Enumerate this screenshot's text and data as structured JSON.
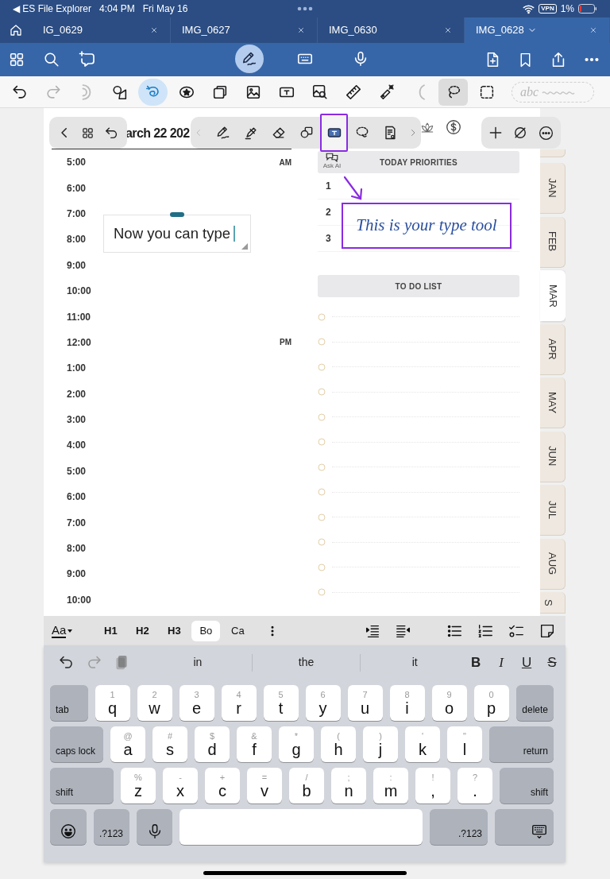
{
  "status_bar": {
    "back_app": "◀ ES File Explorer",
    "time": "4:04 PM",
    "date": "Fri May 16",
    "vpn": "VPN",
    "battery": "1%"
  },
  "doc_tabs": [
    {
      "label": "IG_0629",
      "selected": false
    },
    {
      "label": "IMG_0627",
      "selected": false
    },
    {
      "label": "IMG_0630",
      "selected": false
    },
    {
      "label": "IMG_0628",
      "selected": true
    }
  ],
  "input_modes": [
    {
      "kind": "pen",
      "selected": true
    },
    {
      "kind": "keyboard",
      "selected": false
    },
    {
      "kind": "mic",
      "selected": false
    }
  ],
  "tools": [
    {
      "kind": "undo",
      "selected": false
    },
    {
      "kind": "redo",
      "selected": false
    },
    {
      "kind": "ring",
      "selected": false
    },
    {
      "kind": "shapes",
      "selected": false
    },
    {
      "kind": "swirl",
      "selected": true
    },
    {
      "kind": "sticker",
      "selected": false
    },
    {
      "kind": "pages",
      "selected": false
    },
    {
      "kind": "image",
      "selected": false
    },
    {
      "kind": "textbox",
      "selected": false
    },
    {
      "kind": "imagesearch",
      "selected": false
    },
    {
      "kind": "ruler",
      "selected": false
    },
    {
      "kind": "laser",
      "selected": false
    },
    {
      "kind": "moon",
      "selected": false
    },
    {
      "kind": "lasso",
      "selected": true
    },
    {
      "kind": "select",
      "selected": false
    }
  ],
  "handwriting_preview": "abc",
  "pen_tools": [
    {
      "kind": "pen",
      "selected": false
    },
    {
      "kind": "highlighter",
      "selected": false
    },
    {
      "kind": "eraser",
      "selected": false
    },
    {
      "kind": "shapes",
      "selected": false
    },
    {
      "kind": "text",
      "selected": true
    },
    {
      "kind": "lasso",
      "selected": false
    },
    {
      "kind": "reader",
      "selected": false
    }
  ],
  "planner": {
    "title": "arch 22 202",
    "times": [
      {
        "time": "5:00",
        "meridiem": "AM"
      },
      {
        "time": "6:00"
      },
      {
        "time": "7:00"
      },
      {
        "time": "8:00"
      },
      {
        "time": "9:00"
      },
      {
        "time": "10:00"
      },
      {
        "time": "11:00"
      },
      {
        "time": "12:00",
        "meridiem": "PM"
      },
      {
        "time": "1:00"
      },
      {
        "time": "2:00"
      },
      {
        "time": "3:00"
      },
      {
        "time": "4:00"
      },
      {
        "time": "5:00"
      },
      {
        "time": "6:00"
      },
      {
        "time": "7:00"
      },
      {
        "time": "8:00"
      },
      {
        "time": "9:00"
      },
      {
        "time": "10:00"
      }
    ],
    "ask_ai": "Ask AI",
    "priorities_title": "TODAY PRIORITIES",
    "priorities": [
      "1",
      "2",
      "3"
    ],
    "todo_title": "TO DO LIST"
  },
  "text_box": {
    "text": "Now you can type"
  },
  "annotation": {
    "text": "This is your type tool"
  },
  "month_tabs": [
    {
      "label": "JAN",
      "selected": false
    },
    {
      "label": "FEB",
      "selected": false
    },
    {
      "label": "MAR",
      "selected": true
    },
    {
      "label": "APR",
      "selected": false
    },
    {
      "label": "MAY",
      "selected": false
    },
    {
      "label": "JUN",
      "selected": false
    },
    {
      "label": "JUL",
      "selected": false
    },
    {
      "label": "AUG",
      "selected": false
    },
    {
      "label": "S",
      "selected": false
    }
  ],
  "format_bar": {
    "font_button": "Aa",
    "styles": [
      {
        "label": "H1",
        "selected": false
      },
      {
        "label": "H2",
        "selected": false
      },
      {
        "label": "H3",
        "selected": false
      },
      {
        "label": "Bo",
        "selected": true
      },
      {
        "label": "Ca",
        "selected": false
      }
    ]
  },
  "suggestions": [
    "in",
    "the",
    "it"
  ],
  "text_format_keys": [
    "B",
    "I",
    "U",
    "S"
  ],
  "keyboard": [
    [
      {
        "kind": "mod",
        "label": "tab"
      },
      {
        "kind": "char",
        "label": "q",
        "alt": "1"
      },
      {
        "kind": "char",
        "label": "w",
        "alt": "2"
      },
      {
        "kind": "char",
        "label": "e",
        "alt": "3"
      },
      {
        "kind": "char",
        "label": "r",
        "alt": "4"
      },
      {
        "kind": "char",
        "label": "t",
        "alt": "5"
      },
      {
        "kind": "char",
        "label": "y",
        "alt": "6"
      },
      {
        "kind": "char",
        "label": "u",
        "alt": "7"
      },
      {
        "kind": "char",
        "label": "i",
        "alt": "8"
      },
      {
        "kind": "char",
        "label": "o",
        "alt": "9"
      },
      {
        "kind": "char",
        "label": "p",
        "alt": "0"
      },
      {
        "kind": "mod",
        "label": "delete"
      }
    ],
    [
      {
        "kind": "mod",
        "label": "caps lock"
      },
      {
        "kind": "char",
        "label": "a",
        "alt": "@"
      },
      {
        "kind": "char",
        "label": "s",
        "alt": "#"
      },
      {
        "kind": "char",
        "label": "d",
        "alt": "$"
      },
      {
        "kind": "char",
        "label": "f",
        "alt": "&"
      },
      {
        "kind": "char",
        "label": "g",
        "alt": "*"
      },
      {
        "kind": "char",
        "label": "h",
        "alt": "("
      },
      {
        "kind": "char",
        "label": "j",
        "alt": ")"
      },
      {
        "kind": "char",
        "label": "k",
        "alt": "'"
      },
      {
        "kind": "char",
        "label": "l",
        "alt": "\""
      },
      {
        "kind": "mod",
        "label": "return"
      }
    ],
    [
      {
        "kind": "mod",
        "label": "shift"
      },
      {
        "kind": "char",
        "label": "z",
        "alt": "%"
      },
      {
        "kind": "char",
        "label": "x",
        "alt": "-"
      },
      {
        "kind": "char",
        "label": "c",
        "alt": "+"
      },
      {
        "kind": "char",
        "label": "v",
        "alt": "="
      },
      {
        "kind": "char",
        "label": "b",
        "alt": "/"
      },
      {
        "kind": "char",
        "label": "n",
        "alt": ";"
      },
      {
        "kind": "char",
        "label": "m",
        "alt": ":"
      },
      {
        "kind": "punct",
        "label": ",",
        "alt": "!"
      },
      {
        "kind": "punct",
        "label": ".",
        "alt": "?"
      },
      {
        "kind": "mod",
        "label": "shift"
      }
    ],
    [
      {
        "kind": "emoji"
      },
      {
        "kind": "mod",
        "label": ".?123"
      },
      {
        "kind": "mic"
      },
      {
        "kind": "space"
      },
      {
        "kind": "mod",
        "label": ".?123"
      },
      {
        "kind": "hide"
      }
    ]
  ]
}
